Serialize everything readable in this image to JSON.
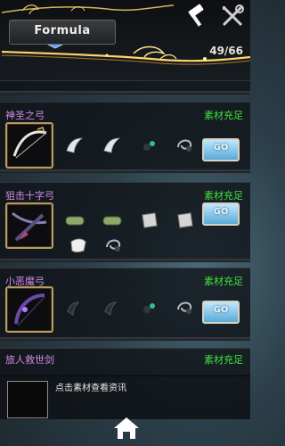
{
  "header": {
    "title": "Formula",
    "count": "49/66",
    "hammer_icon": "hammer-icon",
    "tools_icon": "fork-wrench-icon"
  },
  "recipes": [
    {
      "name": "神圣之弓",
      "status": "素材充足",
      "go_label": "GO",
      "weapon_icon": "bow-icon",
      "materials": [
        "horn-material-icon",
        "horn-material-icon",
        "bead-material-icon",
        "coiled-material-icon"
      ]
    },
    {
      "name": "狙击十字弓",
      "status": "素材充足",
      "go_label": "GO",
      "weapon_icon": "crossbow-icon",
      "materials": [
        "log-material-icon",
        "log-material-icon",
        "metal-plate-material-icon",
        "metal-plate-material-icon",
        "cloth-material-icon",
        "coiled-material-icon"
      ]
    },
    {
      "name": "小恶魔弓",
      "status": "素材充足",
      "go_label": "GO",
      "weapon_icon": "demon-bow-icon",
      "materials": [
        "dark-claw-material-icon",
        "dark-claw-material-icon",
        "bead-material-icon",
        "coiled-material-icon"
      ]
    },
    {
      "name": "旅人救世剑",
      "status": "素材充足"
    }
  ],
  "info": {
    "hint": "点击素材查看资讯"
  },
  "footer": {
    "home_icon": "home-icon"
  },
  "colors": {
    "name": "#d58ae6",
    "status": "#3fe33a",
    "frame_gold": "#b79c62"
  }
}
